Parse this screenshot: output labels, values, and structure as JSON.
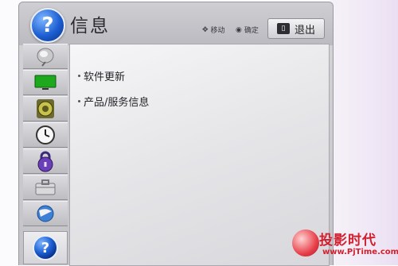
{
  "header": {
    "title": "信息",
    "title_icon": "question-icon",
    "hints": [
      {
        "icon": "move-arrows-icon",
        "label": "移动"
      },
      {
        "icon": "ok-dot-icon",
        "label": "确定"
      }
    ],
    "exit_button": {
      "key_icon": "exit-key-icon",
      "label": "退出"
    }
  },
  "sidebar": {
    "items": [
      {
        "icon": "satellite-dish-icon",
        "active": false
      },
      {
        "icon": "tv-screen-icon",
        "active": false
      },
      {
        "icon": "speaker-icon",
        "active": false
      },
      {
        "icon": "clock-icon",
        "active": false
      },
      {
        "icon": "lock-icon",
        "active": false
      },
      {
        "icon": "toolbox-icon",
        "active": false
      },
      {
        "icon": "globe-icon",
        "active": false
      },
      {
        "icon": "question-icon",
        "active": true
      }
    ]
  },
  "content": {
    "items": [
      {
        "label": "软件更新"
      },
      {
        "label": "产品/服务信息"
      }
    ]
  },
  "watermark": {
    "brand": "投影时代",
    "url": "www.PjTime.com"
  },
  "colors": {
    "panel": "#c9c9cd",
    "content": "#ececef",
    "accent_blue": "#1c5fd2",
    "watermark_red": "#d3202e"
  }
}
